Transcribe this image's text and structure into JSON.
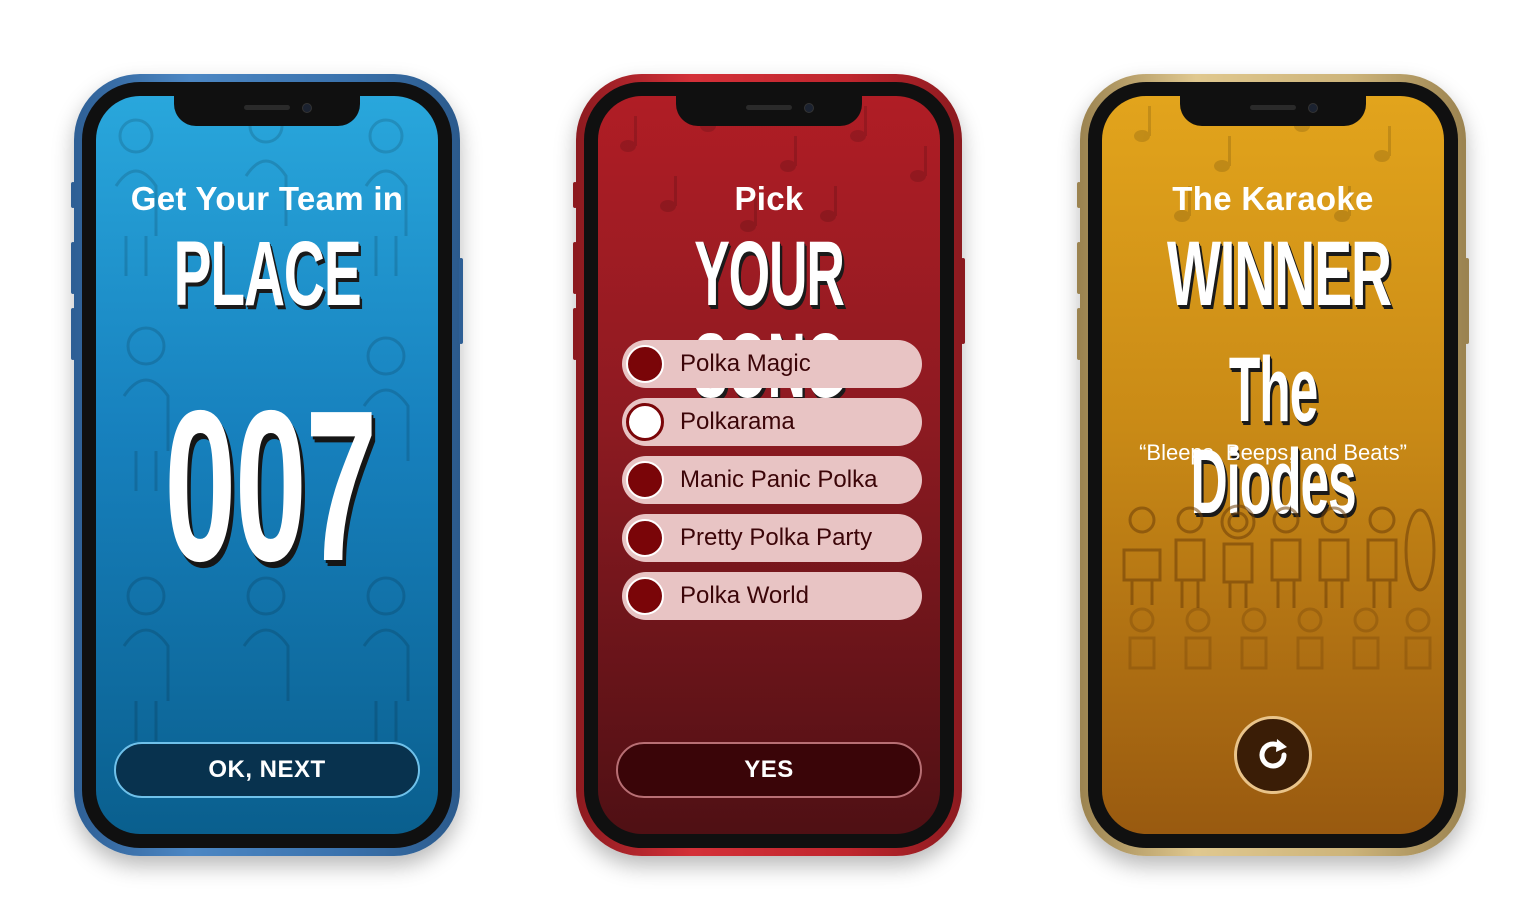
{
  "screens": [
    {
      "theme": "blue",
      "accent": "#1781be",
      "heading_small": "Get Your Team in",
      "heading_big": "PLACE",
      "place_number": "007",
      "button_label": "OK, NEXT"
    },
    {
      "theme": "red",
      "accent": "#8c1a21",
      "heading_small": "Pick",
      "heading_big": "YOUR SONG",
      "songs": [
        {
          "label": "Polka Magic",
          "selected": false
        },
        {
          "label": "Polkarama",
          "selected": true
        },
        {
          "label": "Manic Panic Polka",
          "selected": false
        },
        {
          "label": "Pretty Polka Party",
          "selected": false
        },
        {
          "label": "Polka World",
          "selected": false
        }
      ],
      "button_label": "YES"
    },
    {
      "theme": "gold",
      "accent": "#c98a16",
      "heading_small": "The Karaoke",
      "heading_big": "WINNER",
      "team_name": "The Diodes",
      "song_title": "“Bleeps, Beeps, and Beats”",
      "button_icon": "replay-icon"
    }
  ]
}
